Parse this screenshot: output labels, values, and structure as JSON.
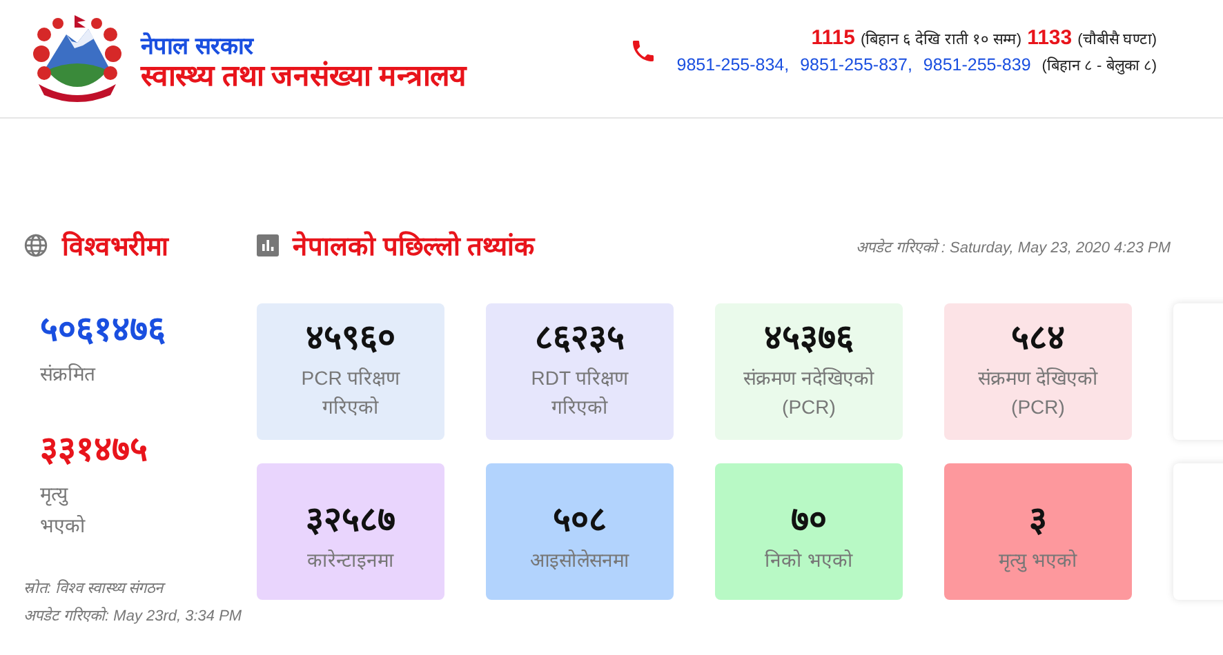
{
  "header": {
    "government": "नेपाल सरकार",
    "ministry": "स्वास्थ्य तथा जनसंख्या मन्त्रालय",
    "hotlines": [
      {
        "number": "1115",
        "hours": "(बिहान ६ देखि राती १० सम्म)"
      },
      {
        "number": "1133",
        "hours": "(चौबीसै घण्टा)"
      }
    ],
    "mobile_numbers": [
      "9851-255-834,",
      "9851-255-837,",
      "9851-255-839"
    ],
    "mobile_hours": "(बिहान ८ - बेलुका ८)"
  },
  "world": {
    "title": "विश्वभरीमा",
    "stats": [
      {
        "value": "५०६१४७६",
        "label": "संक्रमित",
        "color": "#1a4fe0"
      },
      {
        "value": "३३१४७५",
        "label": "मृत्यु\nभएको",
        "color": "#e8141b"
      }
    ],
    "source": "स्रोत: विश्व स्वास्थ्य संगठन",
    "updated": "अपडेट गरिएको: May 23rd, 3:34 PM"
  },
  "nepal": {
    "title": "नेपालको पछिल्लो तथ्यांक",
    "updated": "अपडेट गरिएको : Saturday, May 23, 2020 4:23 PM",
    "cards": [
      {
        "kind": "stat",
        "value": "४५९६०",
        "label": "PCR परिक्षण\nगरिएको",
        "color": "#e3ecfa"
      },
      {
        "kind": "stat",
        "value": "८६२३५",
        "label": "RDT परिक्षण\nगरिएको",
        "color": "#e6e6fc"
      },
      {
        "kind": "stat",
        "value": "४५३७६",
        "label": "संक्रमण नदेखिएको\n(PCR)",
        "color": "#eafaeb"
      },
      {
        "kind": "stat",
        "value": "५८४",
        "label": "संक्रमण देखिएको\n(PCR)",
        "color": "#fce3e6"
      },
      {
        "kind": "blank"
      },
      {
        "kind": "stat",
        "value": "३२५८७",
        "label": "कारेन्टाइनमा",
        "color": "#e9d5fd"
      },
      {
        "kind": "stat",
        "value": "५०८",
        "label": "आइसोलेसनमा",
        "color": "#b2d3fd"
      },
      {
        "kind": "stat",
        "value": "७०",
        "label": "निको भएको",
        "color": "#b8f9c5"
      },
      {
        "kind": "stat",
        "value": "३",
        "label": "मृत्यु भएको",
        "color": "#fd989d"
      },
      {
        "kind": "blank"
      }
    ]
  }
}
